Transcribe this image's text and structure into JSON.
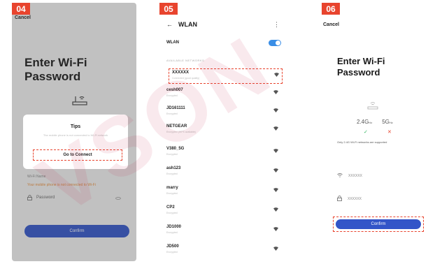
{
  "panels": {
    "step4": {
      "badge": "04",
      "cancel": "Cancel",
      "title_line1": "Enter Wi-Fi",
      "title_line2": "Password",
      "dialog_title": "Tips",
      "dialog_message": "The mobile phone is not connected to Wi-Fi network",
      "go_to_connect": "Go to Connect",
      "wifi_name_label": "Wi-Fi Name",
      "warning": "Your mobile phone is not connected to Wi-Fi",
      "password_placeholder": "Password",
      "confirm": "Confirm"
    },
    "step5": {
      "badge": "05",
      "header": "WLAN",
      "wlan_label": "WLAN",
      "section": "AVAILABLE NETWORKS",
      "networks": [
        {
          "name": "XXXXXX",
          "sub": "Connected (good quality)"
        },
        {
          "name": "cesh007",
          "sub": "Encrypted"
        },
        {
          "name": "JD161111",
          "sub": "Encrypted"
        },
        {
          "name": "NETGEAR",
          "sub": "Encrypted (WPS available)"
        },
        {
          "name": "V380_5G",
          "sub": "Encrypted"
        },
        {
          "name": "ash123",
          "sub": "Encrypted"
        },
        {
          "name": "marry",
          "sub": "Encrypted"
        },
        {
          "name": "CP2",
          "sub": "Encrypted"
        },
        {
          "name": "JD1000",
          "sub": "Encrypted"
        },
        {
          "name": "JD500",
          "sub": "Encrypted"
        }
      ]
    },
    "step6": {
      "badge": "06",
      "cancel": "Cancel",
      "title_line1": "Enter Wi-Fi",
      "title_line2": "Password",
      "band_24": "2.4G",
      "band_5": "5G",
      "band_unit": "Hz",
      "note": "Only 2.4G Wi-Fi networks are supported",
      "wifi_value": "XXXXXX",
      "password_value": "XXXXXX",
      "confirm": "Confirm"
    }
  },
  "watermark": "VSON",
  "colors": {
    "badge": "#e8442e",
    "button": "#3355c8",
    "toggle": "#3a8ee6",
    "check": "#2db35b"
  }
}
